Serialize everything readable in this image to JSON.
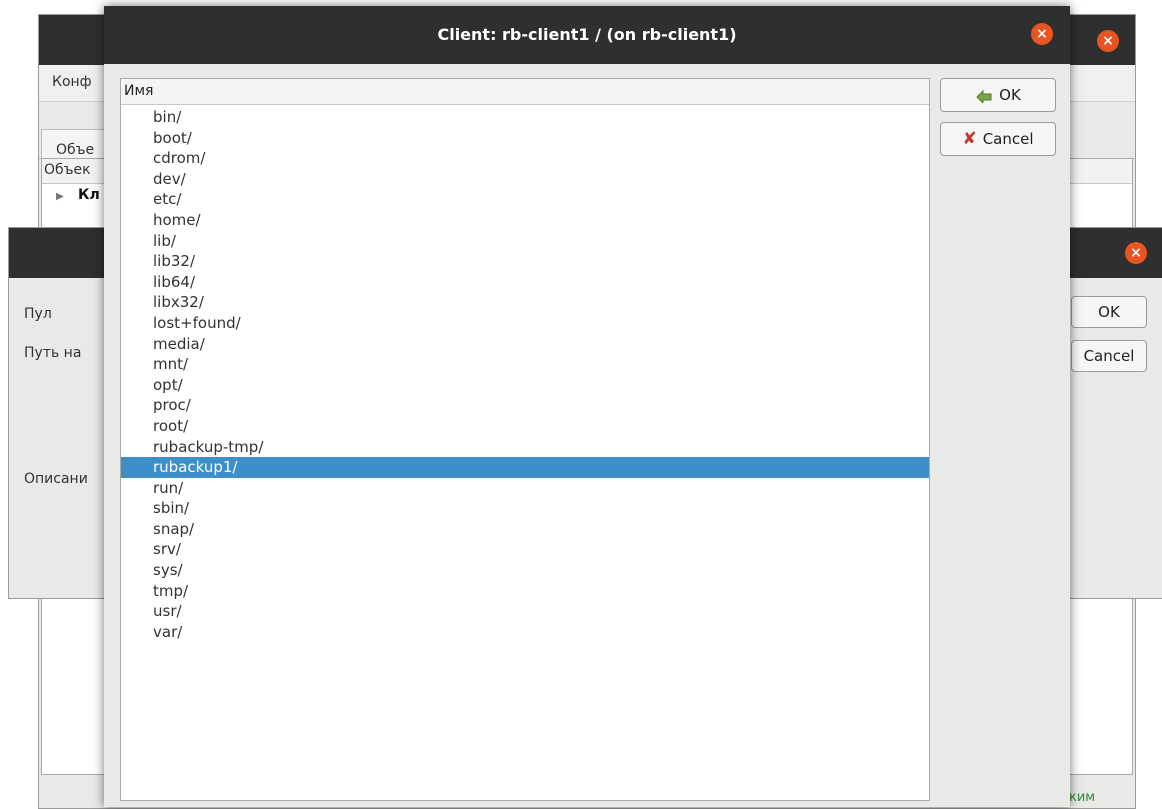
{
  "back_window": {
    "menu_item": "Конф",
    "tab": "Объе",
    "tree_header": "Объек",
    "tree_row": "Кл",
    "status_text": "ким"
  },
  "middle_dialog": {
    "label_pool": "Пул",
    "label_path": "Путь на",
    "label_description": "Описани",
    "ok_label": "OK",
    "cancel_label": "Cancel"
  },
  "front_dialog": {
    "title": "Client: rb-client1 / (on rb-client1)",
    "column_header": "Имя",
    "ok_label": "OK",
    "cancel_label": "Cancel",
    "selected_index": 18,
    "items": [
      "bin/",
      "boot/",
      "cdrom/",
      "dev/",
      "etc/",
      "home/",
      "lib/",
      "lib32/",
      "lib64/",
      "libx32/",
      "lost+found/",
      "media/",
      "mnt/",
      "opt/",
      "proc/",
      "root/",
      "rubackup-tmp/",
      "rubackup1/",
      "run/",
      "sbin/",
      "snap/",
      "srv/",
      "sys/",
      "tmp/",
      "usr/",
      "var/"
    ]
  },
  "colors": {
    "titlebar": "#2f2f2f",
    "close": "#e95420",
    "selection": "#3d8ec9"
  }
}
